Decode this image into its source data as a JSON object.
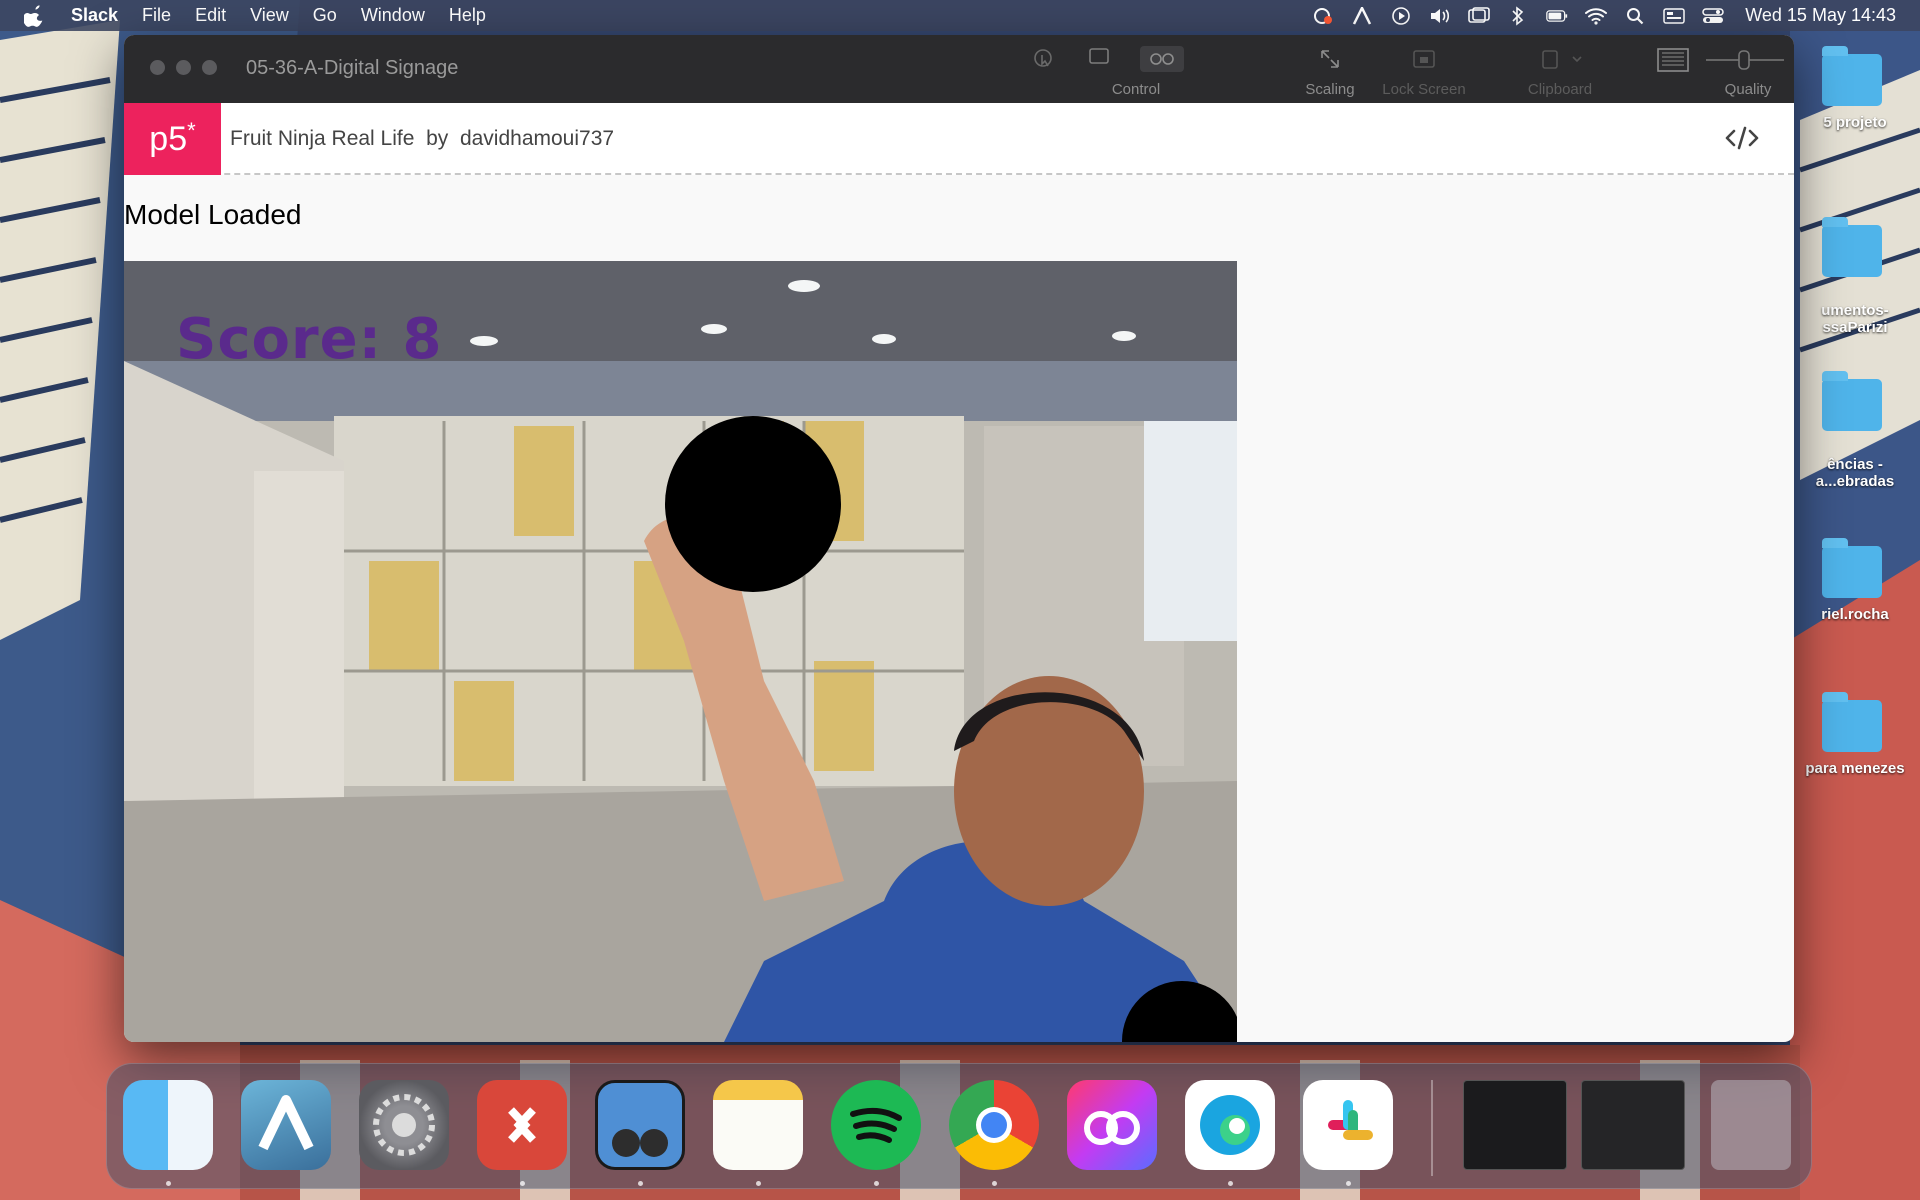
{
  "menubar": {
    "app_name": "Slack",
    "menus": [
      "File",
      "Edit",
      "View",
      "Go",
      "Window",
      "Help"
    ],
    "clock": "Wed 15 May  14:43"
  },
  "desktop_items": [
    {
      "label": "5 projeto"
    },
    {
      "label": "umentos-\nssaParizi"
    },
    {
      "label": "ências -\na...ebradas"
    },
    {
      "label": "riel.rocha"
    },
    {
      "label": "para menezes"
    }
  ],
  "window": {
    "title": "05-36-A-Digital Signage",
    "toolbar": {
      "control_label": "Control",
      "scaling_label": "Scaling",
      "lock_screen_label": "Lock Screen",
      "clipboard_label": "Clipboard",
      "quality_label": "Quality"
    }
  },
  "p5": {
    "logo_text": "p5",
    "logo_star": "*",
    "sketch_title": "Fruit Ninja Real Life",
    "by_label": "by",
    "author": "davidhamoui737",
    "model_status": "Model Loaded",
    "score_text": "Score: 8"
  },
  "dock": {
    "apps": [
      "Finder",
      "Affinity",
      "System Settings",
      "Microsoft Remote Desktop",
      "Preview",
      "Notes",
      "Spotify",
      "Google Chrome",
      "Creative Cloud",
      "Microsoft Edge",
      "Slack"
    ]
  }
}
